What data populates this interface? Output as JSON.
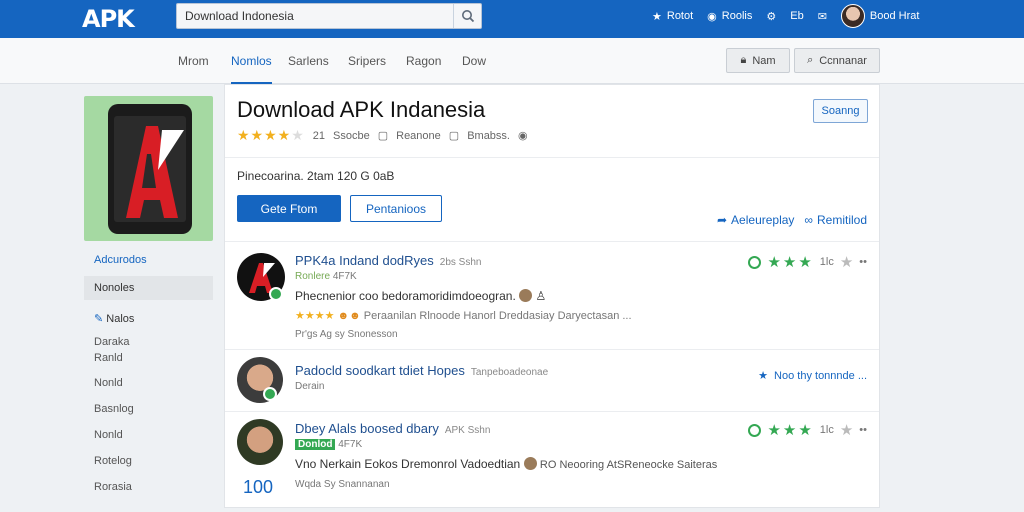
{
  "header": {
    "logo": "APK",
    "search_value": "Download Indonesia",
    "links": [
      {
        "icon": "star-icon",
        "label": "Rotot"
      },
      {
        "icon": "bell-icon",
        "label": "Roolis"
      },
      {
        "icon": "gear-icon",
        "label": ""
      },
      {
        "icon": "grid-icon",
        "label": "Eb"
      },
      {
        "icon": "chat-icon",
        "label": ""
      },
      {
        "icon": "avatar",
        "label": "Bood Hrat"
      }
    ]
  },
  "nav": {
    "tabs": [
      "Mrom",
      "Nomlos",
      "Sarlens",
      "Sripers",
      "Ragon",
      "Dow"
    ],
    "active": "Nomlos",
    "btn_login": "Nam",
    "btn_connect": "Ccnnanar"
  },
  "sidebar": {
    "items": [
      "Adcurodos",
      "Nonoles",
      "Nalos",
      "Daraka",
      "Ranld",
      "Nonld",
      "Basnlog",
      "Nonld",
      "Rotelog",
      "Rorasia"
    ]
  },
  "app": {
    "title": "Download APK Indanesia",
    "rating_text": "21",
    "rating_count": "Ssocbe",
    "meta1": "Reanone",
    "meta2": "Bmabss.",
    "top_right_btn": "Soanng",
    "info_line": "Pinecoarina. 2tam 120 G 0aB",
    "primary_btn": "Gete Ftom",
    "secondary_btn": "Pentanioos",
    "action_link1": "Aeleureplay",
    "action_link2": "Remitilod",
    "colors": {
      "brand": "#1565c0",
      "accent_green": "#34a853",
      "star": "#f2b01e"
    }
  },
  "reviews": [
    {
      "name": "PPK4a Indand dodRyes",
      "meta": "2bs Sshn",
      "tag1": "Ronlere",
      "tag2": "4F7K",
      "text": "Phecnenior coo bedoramoridimdoeogran.",
      "sub": "Peraanilan  Rlnoode Hanorl  Dreddasiay Daryectasan ...",
      "stars_badge": "Stars",
      "footer": "Pr'gs  Ag  sy  Snonesson",
      "right_text": "1lc"
    },
    {
      "name": "Padocld soodkart tdiet Hopes",
      "meta": "Tanpeboadeonae",
      "tag1": "Derain",
      "tag2": "",
      "text": "",
      "sub": "",
      "stars_badge": "",
      "footer": "",
      "right_text": "Noo thy tonnnde ..."
    },
    {
      "name": "Dbey Alals boosed dbary",
      "meta": "APK Sshn",
      "tag1": "Donlod",
      "tag2": "4F7K",
      "text": "Vno Nerkain Eokos Dremonrol Vadoedtian",
      "sub": "RO Neooring AtSReneocke Saiteras",
      "stars_badge": "",
      "footer": "Wqda  Sy  Snannanan",
      "right_text": "1lc",
      "like_count": "100"
    }
  ]
}
